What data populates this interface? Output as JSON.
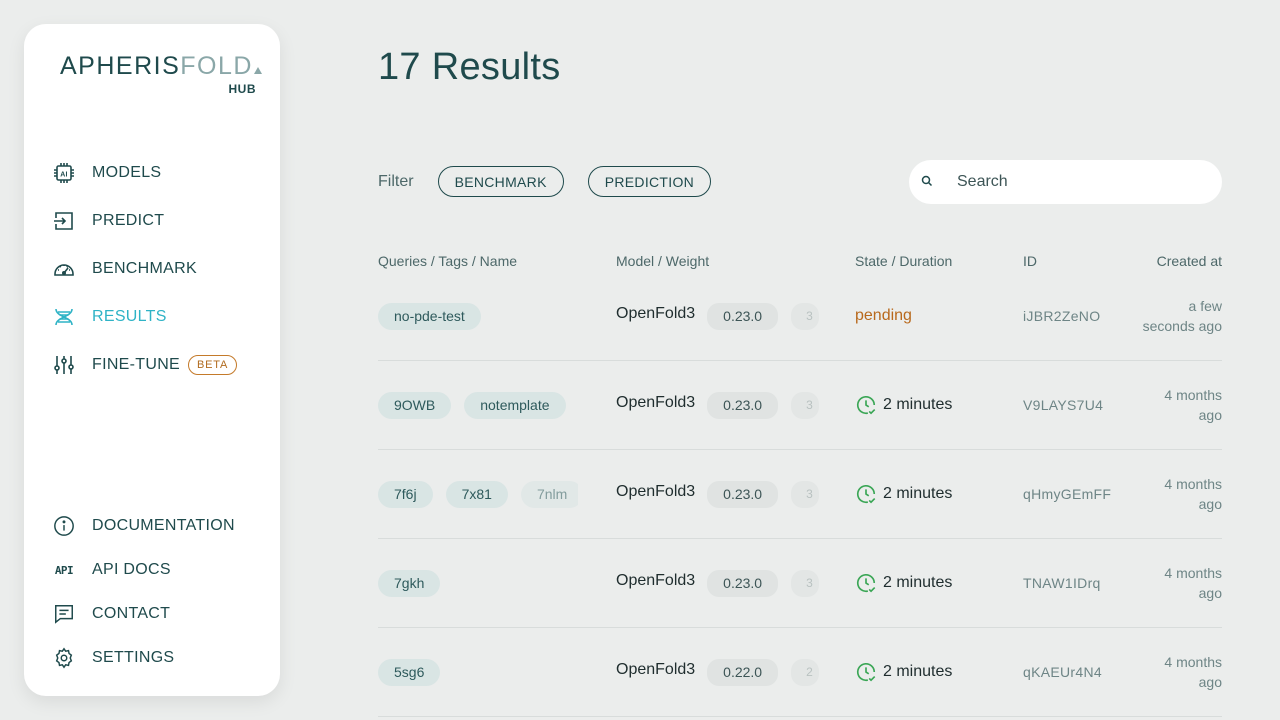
{
  "brand": {
    "name_part1": "APHERIS",
    "name_part2": "FOLD",
    "sub": "HUB"
  },
  "nav": {
    "models": "MODELS",
    "predict": "PREDICT",
    "benchmark": "BENCHMARK",
    "results": "RESULTS",
    "finetune": "FINE-TUNE",
    "beta": "BETA",
    "documentation": "DOCUMENTATION",
    "api_icon": "API",
    "api_docs": "API DOCS",
    "contact": "CONTACT",
    "settings": "SETTINGS"
  },
  "header": {
    "title": "17 Results"
  },
  "filter": {
    "label": "Filter",
    "chips": [
      "BENCHMARK",
      "PREDICTION"
    ],
    "search_placeholder": "Search"
  },
  "table": {
    "columns": [
      "Queries / Tags / Name",
      "Model / Weight",
      "State / Duration",
      "ID",
      "Created at"
    ],
    "rows": [
      {
        "tags": [
          "no-pde-test"
        ],
        "model": "OpenFold3",
        "version": "0.23.0",
        "version_extra": "3",
        "state": "pending",
        "duration": "",
        "id": "iJBR2ZeNO",
        "created_line1": "a few",
        "created_line2": "seconds ago"
      },
      {
        "tags": [
          "9OWB",
          "notemplate"
        ],
        "model": "OpenFold3",
        "version": "0.23.0",
        "version_extra": "3",
        "state": "done",
        "duration": "2 minutes",
        "id": "V9LAYS7U4",
        "created_line1": "4 months",
        "created_line2": "ago"
      },
      {
        "tags": [
          "7f6j",
          "7x81",
          "7nlm"
        ],
        "model": "OpenFold3",
        "version": "0.23.0",
        "version_extra": "3",
        "state": "done",
        "duration": "2 minutes",
        "id": "qHmyGEmFF",
        "created_line1": "4 months",
        "created_line2": "ago"
      },
      {
        "tags": [
          "7gkh"
        ],
        "model": "OpenFold3",
        "version": "0.23.0",
        "version_extra": "3",
        "state": "done",
        "duration": "2 minutes",
        "id": "TNAW1IDrq",
        "created_line1": "4 months",
        "created_line2": "ago"
      },
      {
        "tags": [
          "5sg6"
        ],
        "model": "OpenFold3",
        "version": "0.22.0",
        "version_extra": "2",
        "state": "done",
        "duration": "2 minutes",
        "id": "qKAEUr4N4",
        "created_line1": "4 months",
        "created_line2": "ago"
      }
    ]
  },
  "colors": {
    "accent": "#2fb3c6",
    "primary": "#1f4a4c",
    "pending": "#b8691c",
    "success": "#3aa655",
    "beta": "#c47a2a"
  }
}
